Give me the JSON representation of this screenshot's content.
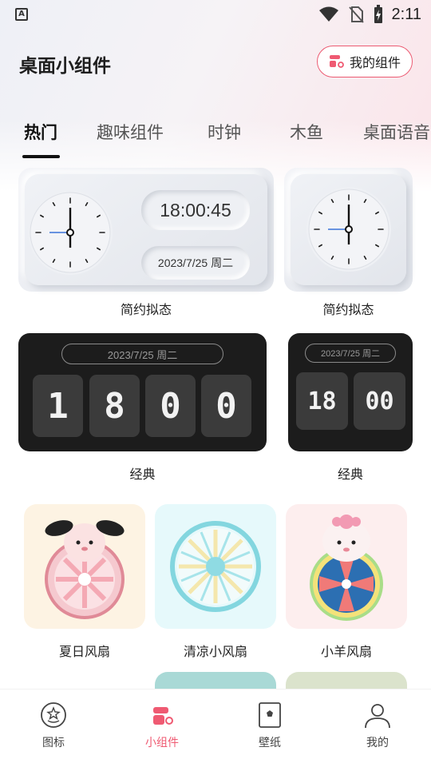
{
  "status_bar": {
    "time": "2:11"
  },
  "header": {
    "title": "桌面小组件",
    "my_widgets_label": "我的组件"
  },
  "tabs": [
    {
      "label": "热门",
      "active": true
    },
    {
      "label": "趣味组件",
      "active": false
    },
    {
      "label": "时钟",
      "active": false
    },
    {
      "label": "木鱼",
      "active": false
    },
    {
      "label": "桌面语音",
      "active": false
    }
  ],
  "widgets": {
    "neumorphic_large": {
      "time": "18:00:45",
      "date": "2023/7/25 周二",
      "label": "简约拟态"
    },
    "neumorphic_small": {
      "label": "简约拟态"
    },
    "classic_large": {
      "date": "2023/7/25  周二",
      "digits": [
        "1",
        "8",
        "0",
        "0"
      ],
      "label": "经典"
    },
    "classic_small": {
      "date": "2023/7/25  周二",
      "digits": [
        "18",
        "00"
      ],
      "label": "经典"
    },
    "fans": [
      {
        "label": "夏日风扇",
        "bg": "#fdf3e3"
      },
      {
        "label": "清凉小风扇",
        "bg": "#e6f9fb"
      },
      {
        "label": "小羊风扇",
        "bg": "#fdeeee"
      }
    ]
  },
  "bottom_nav": [
    {
      "label": "图标",
      "icon": "star-face-icon",
      "active": false
    },
    {
      "label": "小组件",
      "icon": "widgets-icon",
      "active": true
    },
    {
      "label": "壁纸",
      "icon": "wallpaper-icon",
      "active": false
    },
    {
      "label": "我的",
      "icon": "person-icon",
      "active": false
    }
  ],
  "colors": {
    "accent": "#ef5a72",
    "dark_card": "#1c1c1c"
  }
}
